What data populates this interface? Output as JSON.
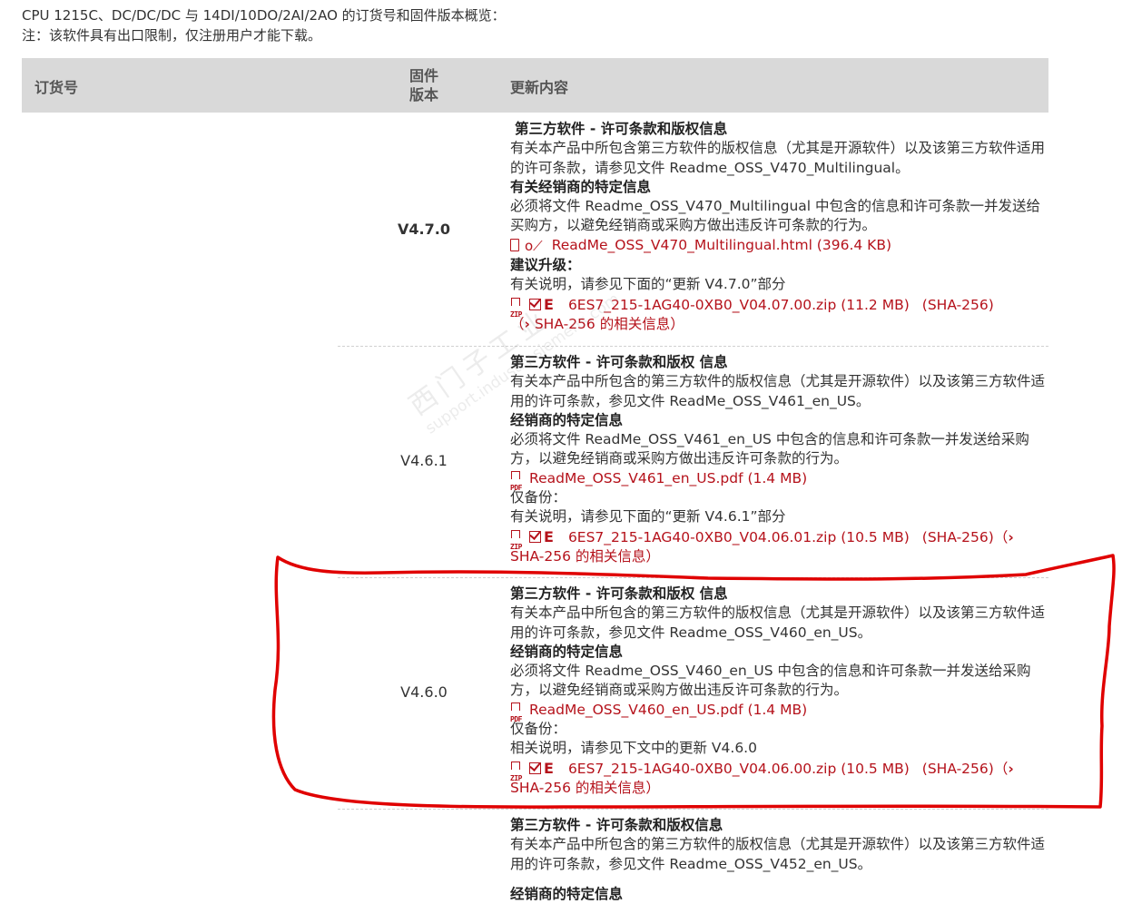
{
  "intro": {
    "line1": "CPU 1215C、DC/DC/DC 与 14DI/10DO/2AI/2AO 的订货号和固件版本概览：",
    "line2": "注：该软件具有出口限制，仅注册用户才能下载。"
  },
  "table_header": {
    "order_no": "订货号",
    "fw_line1": "固件",
    "fw_line2": "版本",
    "updates": "更新内容"
  },
  "watermark": {
    "cn": "西门子工业",
    "en": "support.industry.siemens.com"
  },
  "colors": {
    "link": "#b5121b",
    "header_bg": "#d9d9d9",
    "annotation": "#e00000"
  },
  "rows": [
    {
      "version": "V4.7.0",
      "third_party_title": "第三方软件 - 许可条款和版权信息",
      "third_party_text": "有关本产品中所包含第三方软件的版权信息（尤其是开源软件）以及该第三方软件适用的许可条款，请参见文件 Readme_OSS_V470_Multilingual。",
      "dealer_title": "有关经销商的特定信息",
      "dealer_text": "必须将文件 Readme_OSS_V470_Multilingual 中包含的信息和许可条款一并发送给买购方，以避免经销商或采购方做出违反许可条款的行为。",
      "readme_link": "ReadMe_OSS_V470_Multilingual.html (396.4 KB)",
      "upgrade_title": "建议升级：",
      "upgrade_text": "有关说明，请参见下面的“更新 V4.7.0”部分",
      "zip_link": "6ES7_215-1AG40-0XB0_V04.07.00.zip (11.2 MB)",
      "sha_link": "(SHA-256)",
      "sha_info": "SHA-256 的相关信息"
    },
    {
      "version": "V4.6.1",
      "third_party_title": "第三方软件 - 许可条款和版权 信息",
      "third_party_text": "有关本产品中所包含的第三方软件的版权信息（尤其是开源软件）以及该第三方软件适用的许可条款，参见文件 ReadMe_OSS_V461_en_US。",
      "dealer_title": "经销商的特定信息",
      "dealer_text": "必须将文件 ReadMe_OSS_V461_en_US 中包含的信息和许可条款一并发送给采购方，以避免经销商或采购方做出违反许可条款的行为。",
      "readme_link": "ReadMe_OSS_V461_en_US.pdf (1.4 MB)",
      "backup_title": "仅备份：",
      "backup_text": "有关说明，请参见下面的“更新 V4.6.1”部分",
      "zip_link": "6ES7_215-1AG40-0XB0_V04.06.01.zip (10.5 MB)",
      "sha_link": "(SHA-256)",
      "sha_info": "SHA-256 的相关信息"
    },
    {
      "version": "V4.6.0",
      "third_party_title": "第三方软件 - 许可条款和版权 信息",
      "third_party_text": "有关本产品中所包含的第三方软件的版权信息（尤其是开源软件）以及该第三方软件适用的许可条款，参见文件 Readme_OSS_V460_en_US。",
      "dealer_title": "经销商的特定信息",
      "dealer_text": "必须将文件 Readme_OSS_V460_en_US 中包含的信息和许可条款一并发送给采购方，以避免经销商或采购方做出违反许可条款的行为。",
      "readme_link": "ReadMe_OSS_V460_en_US.pdf (1.4 MB)",
      "backup_title": "仅备份：",
      "backup_text": "相关说明，请参见下文中的更新 V4.6.0",
      "zip_link": "6ES7_215-1AG40-0XB0_V04.06.00.zip (10.5 MB)",
      "sha_link": "(SHA-256)",
      "sha_info": "SHA-256 的相关信息"
    },
    {
      "third_party_title": "第三方软件 - 许可条款和版权信息",
      "third_party_text": "有关本产品中所包含的第三方软件的版权信息（尤其是开源软件）以及该第三方软件适用的许可条款，参见文件 Readme_OSS_V452_en_US。",
      "dealer_title": "经销商的特定信息"
    }
  ]
}
